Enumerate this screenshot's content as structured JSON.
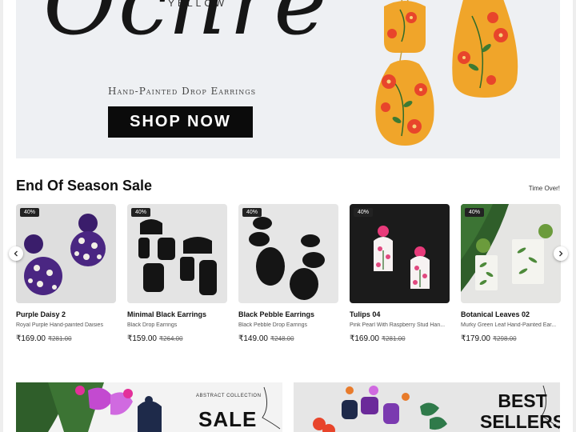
{
  "hero": {
    "overline": "YELLOW",
    "script_title": "Ochre",
    "subtitle": "Hand-Painted Drop Earrings",
    "cta_label": "SHOP NOW"
  },
  "sale_section": {
    "title": "End Of Season Sale",
    "timer_text": "Time Over!",
    "prev_icon": "chevron-left-icon",
    "next_icon": "chevron-right-icon",
    "products": [
      {
        "badge": "40%",
        "name": "Purple Daisy 2",
        "desc": "Royal Purple Hand-painted Daisies",
        "price": "₹169.00",
        "old_price": "₹281.00"
      },
      {
        "badge": "40%",
        "name": "Minimal Black Earrings",
        "desc": "Black Drop Earrings",
        "price": "₹159.00",
        "old_price": "₹264.00"
      },
      {
        "badge": "40%",
        "name": "Black Pebble Earrings",
        "desc": "Black Pebble Drop Earrings",
        "price": "₹149.00",
        "old_price": "₹248.00"
      },
      {
        "badge": "40%",
        "name": "Tulips 04",
        "desc": "Pink Pearl With Raspberry Stud Han...",
        "price": "₹169.00",
        "old_price": "₹281.00"
      },
      {
        "badge": "40%",
        "name": "Botanical Leaves 02",
        "desc": "Murky Green Leaf Hand-Painted Ear...",
        "price": "₹179.00",
        "old_price": "₹298.00"
      }
    ]
  },
  "banners": {
    "sale": {
      "tag": "ABSTRACT COLLECTION",
      "title": "SALE"
    },
    "best": {
      "line1": "BEST",
      "line2": "SELLERS"
    }
  },
  "colors": {
    "hero_bg": "#eef0f3",
    "earring_yellow": "#f0a52a",
    "flower_red": "#e8452b",
    "button_black": "#0b0b0b"
  }
}
